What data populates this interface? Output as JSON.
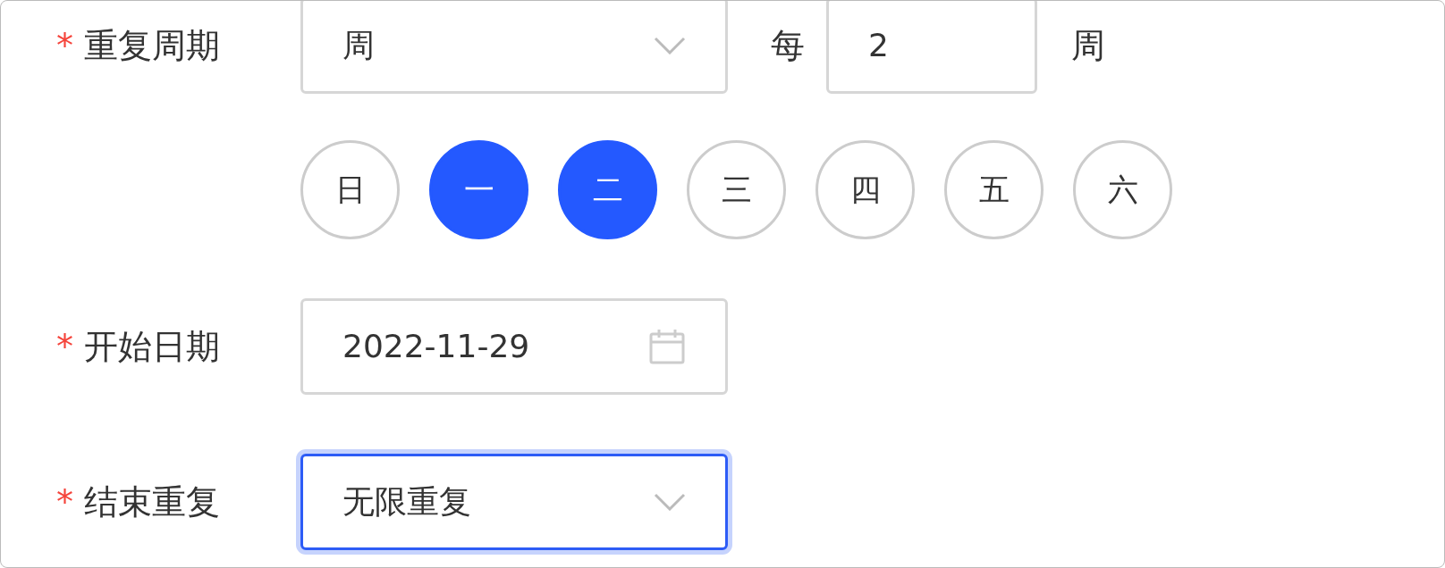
{
  "fields": [
    {
      "kind": "repeat",
      "required_mark": "*",
      "label": "重复周期",
      "select": {
        "value": "周"
      },
      "every_label": "每",
      "interval": "2",
      "unit": "周",
      "weekdays": [
        {
          "label": "日",
          "selected": false
        },
        {
          "label": "一",
          "selected": true
        },
        {
          "label": "二",
          "selected": true
        },
        {
          "label": "三",
          "selected": false
        },
        {
          "label": "四",
          "selected": false
        },
        {
          "label": "五",
          "selected": false
        },
        {
          "label": "六",
          "selected": false
        }
      ]
    },
    {
      "kind": "date",
      "required_mark": "*",
      "label": "开始日期",
      "value": "2022-11-29"
    },
    {
      "kind": "select",
      "required_mark": "*",
      "label": "结束重复",
      "value": "无限重复",
      "focused": true
    }
  ]
}
